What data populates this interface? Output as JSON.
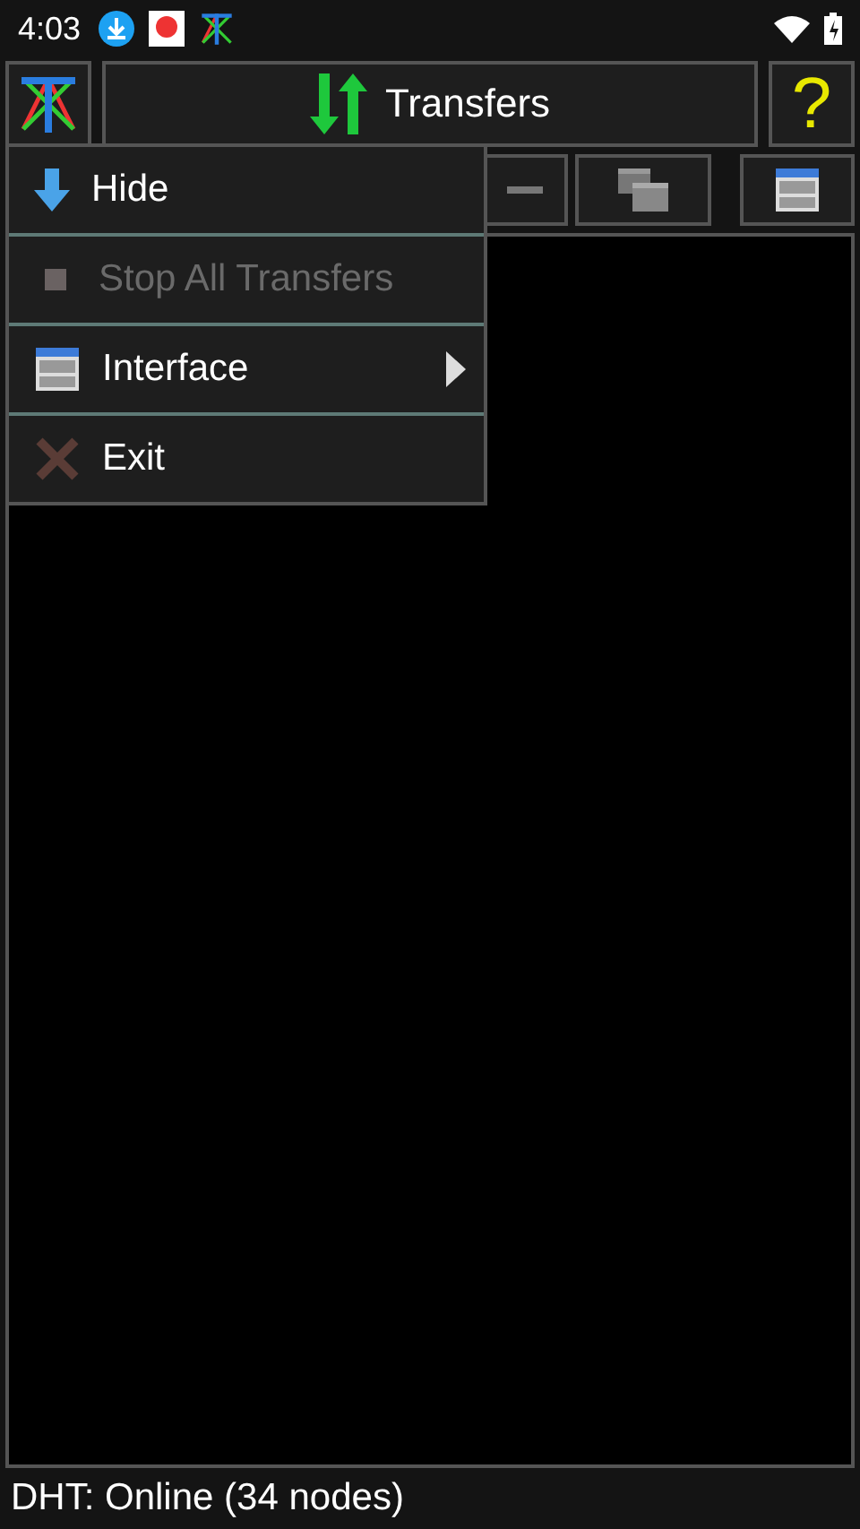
{
  "status_bar": {
    "time": "4:03"
  },
  "header": {
    "title": "Transfers",
    "help": "?"
  },
  "menu": {
    "items": [
      {
        "label": "Hide",
        "disabled": false,
        "submenu": false
      },
      {
        "label": "Stop All Transfers",
        "disabled": true,
        "submenu": false
      },
      {
        "label": "Interface",
        "disabled": false,
        "submenu": true
      },
      {
        "label": "Exit",
        "disabled": false,
        "submenu": false
      }
    ]
  },
  "footer": {
    "text": "DHT: Online (34 nodes)"
  }
}
